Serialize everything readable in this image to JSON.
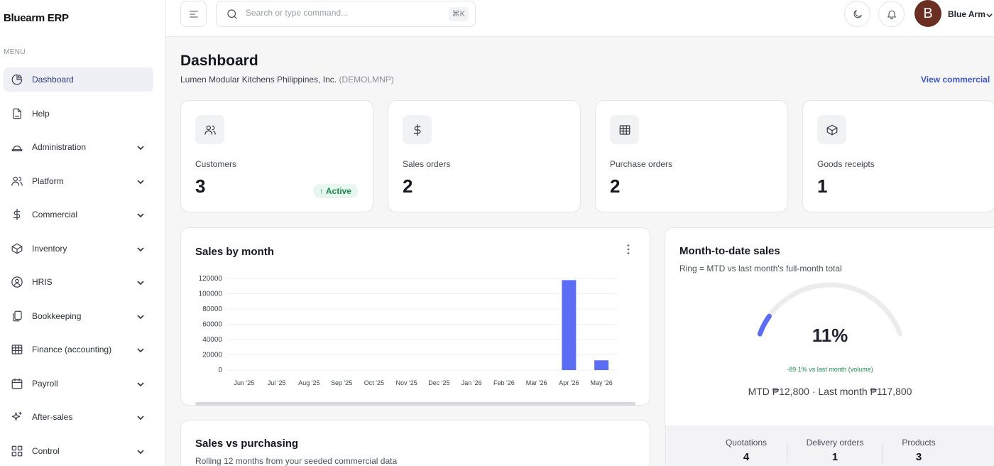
{
  "brand": "Bluearm ERP",
  "menu_label": "MENU",
  "nav": [
    {
      "label": "Dashboard",
      "icon": "pie-chart-icon"
    },
    {
      "label": "Help",
      "icon": "document-icon"
    },
    {
      "label": "Administration",
      "icon": "hat-icon"
    },
    {
      "label": "Platform",
      "icon": "users-icon"
    },
    {
      "label": "Commercial",
      "icon": "dollar-icon"
    },
    {
      "label": "Inventory",
      "icon": "box-icon"
    },
    {
      "label": "HRIS",
      "icon": "user-circle-icon"
    },
    {
      "label": "Bookkeeping",
      "icon": "copy-icon"
    },
    {
      "label": "Finance (accounting)",
      "icon": "table-icon"
    },
    {
      "label": "Payroll",
      "icon": "calendar-icon"
    },
    {
      "label": "After-sales",
      "icon": "sparkle-icon"
    },
    {
      "label": "Control",
      "icon": "grid-icon"
    }
  ],
  "topbar": {
    "search_placeholder": "Search or type command...",
    "shortcut": "⌘K",
    "avatar_initial": "B",
    "user_name": "Blue Arm"
  },
  "page": {
    "title": "Dashboard",
    "company": "Lumen Modular Kitchens Philippines, Inc.",
    "company_code": "(DEMOLMNP)",
    "view_link": "View commercial →"
  },
  "stats": [
    {
      "label": "Customers",
      "value": "3",
      "badge": "↑ Active",
      "icon": "users-icon"
    },
    {
      "label": "Sales orders",
      "value": "2",
      "icon": "dollar-icon"
    },
    {
      "label": "Purchase orders",
      "value": "2",
      "icon": "table-icon"
    },
    {
      "label": "Goods receipts",
      "value": "1",
      "icon": "box-icon"
    }
  ],
  "sales_chart": {
    "title": "Sales by month",
    "accent": "#5b6cf5"
  },
  "chart_data": {
    "type": "bar",
    "categories": [
      "Jun '25",
      "Jul '25",
      "Aug '25",
      "Sep '25",
      "Oct '25",
      "Nov '25",
      "Dec '25",
      "Jan '26",
      "Feb '26",
      "Mar '26",
      "Apr '26",
      "May '26"
    ],
    "values": [
      0,
      0,
      0,
      0,
      0,
      0,
      0,
      0,
      0,
      0,
      117800,
      12800
    ],
    "yticks": [
      0,
      20000,
      40000,
      60000,
      80000,
      100000,
      120000
    ],
    "ylim": [
      0,
      120000
    ],
    "grid": true
  },
  "mtd": {
    "title": "Month-to-date sales",
    "subtitle": "Ring = MTD vs last month's full-month total",
    "percent_label": "11%",
    "percent": 0.11,
    "delta": "-89.1% vs last month (volume)",
    "summary": "MTD ₱12,800 · Last month ₱117,800",
    "ring_color": "#5b6cf5",
    "track_color": "#ececee"
  },
  "mini_stats": [
    {
      "label": "Quotations",
      "value": "4"
    },
    {
      "label": "Delivery orders",
      "value": "1"
    },
    {
      "label": "Products",
      "value": "3"
    }
  ],
  "sales_vs": {
    "title": "Sales vs purchasing",
    "subtitle": "Rolling 12 months from your seeded commercial data"
  }
}
